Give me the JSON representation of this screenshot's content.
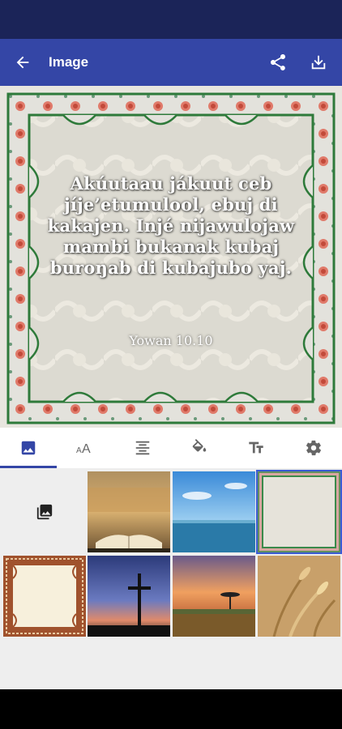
{
  "app_bar": {
    "title": "Image",
    "back_icon": "arrow-back-icon",
    "share_icon": "share-icon",
    "download_icon": "download-icon"
  },
  "card": {
    "verse": "Akúutaau jákuut ceb jíje’etumulool, ebuj di kakajen. Injé nijawulojaw mambi bukanak kubaj buroŋab di kubajubo yaj.",
    "reference": "Yowan 10.10"
  },
  "tabs": [
    {
      "name": "image",
      "icon": "image-icon",
      "active": true
    },
    {
      "name": "font",
      "icon": "font-size-icon",
      "active": false
    },
    {
      "name": "align",
      "icon": "align-center-icon",
      "active": false
    },
    {
      "name": "color",
      "icon": "paint-bucket-icon",
      "active": false
    },
    {
      "name": "text-style",
      "icon": "text-format-icon",
      "active": false
    },
    {
      "name": "settings",
      "icon": "gear-icon",
      "active": false
    }
  ],
  "thumbnails": [
    {
      "name": "choose-from-gallery",
      "icon": "photo-library-icon"
    },
    {
      "name": "open-bible"
    },
    {
      "name": "sky-and-sea"
    },
    {
      "name": "ornate-green-border",
      "selected": true
    },
    {
      "name": "brown-frame"
    },
    {
      "name": "cross-at-dusk"
    },
    {
      "name": "tree-at-sunset"
    },
    {
      "name": "wheat-field"
    }
  ],
  "colors": {
    "status_bar": "#1b2458",
    "app_bar": "#3446a6",
    "accent": "#3446a6"
  }
}
